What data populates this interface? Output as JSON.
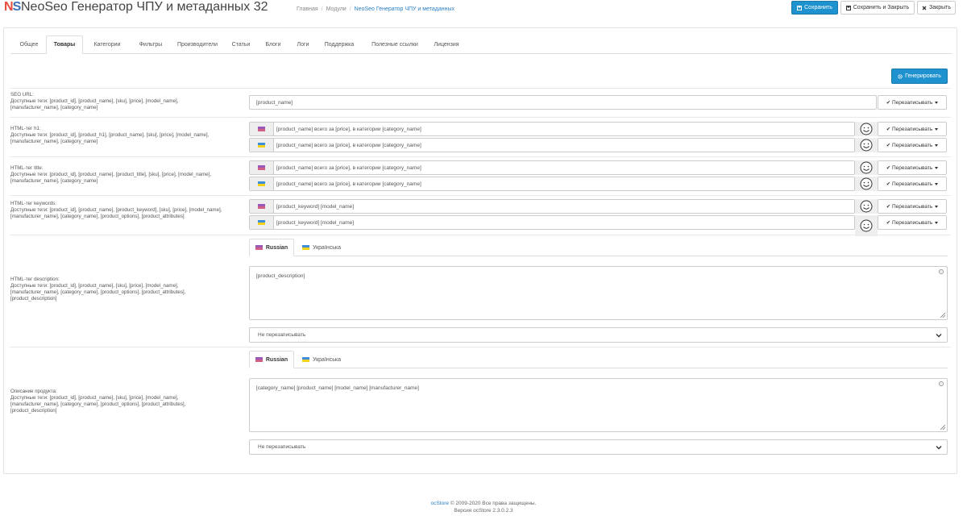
{
  "header": {
    "logo_n": "N",
    "logo_s": "S",
    "title": "NeoSeo Генератор ЧПУ и метаданных 32",
    "breadcrumbs": [
      "Главная",
      "Модули",
      "NeoSeo Генератор ЧПУ и метаданных"
    ],
    "save_label": "Сохранить",
    "save_close_label": "Сохранить и Закрыть",
    "close_label": "Закрыть"
  },
  "tabs": [
    {
      "label": "Общее"
    },
    {
      "label": "Товары"
    },
    {
      "label": "Категории"
    },
    {
      "label": "Фильтры"
    },
    {
      "label": "Производители"
    },
    {
      "label": "Статьи"
    },
    {
      "label": "Блоги"
    },
    {
      "label": "Логи"
    },
    {
      "label": "Поддержка"
    },
    {
      "label": "Полезные ссылки"
    },
    {
      "label": "Лицензия"
    }
  ],
  "generate_label": "Генерировать",
  "overwrite_label": "Перезаписывать",
  "languages": {
    "ru": "Russian",
    "ua": "Українська"
  },
  "seo_url": {
    "title": "SEO URL:",
    "tags": "Доступные теги: [product_id], [product_name], [sku], [price], [model_name], [manufacturer_name], [category_name]",
    "value": "[product_name]"
  },
  "h1": {
    "title": "HTML-тег h1:",
    "tags": "Доступные теги: [product_id], [product_h1], [product_name], [sku], [price], [model_name], [manufacturer_name], [category_name]",
    "ru": "[product_name] всего за [price], в категории [category_name]",
    "ua": "[product_name] всего за [price], в категории [category_name]"
  },
  "title_tag": {
    "title": "HTML-тег title:",
    "tags": "Доступные теги: [product_id], [product_name], [product_title], [sku], [price], [model_name], [manufacturer_name], [category_name]",
    "ru": "[product_name] всего за [price], в категории [category_name]",
    "ua": "[product_name] всего за [price], в категории [category_name]"
  },
  "keywords": {
    "title": "HTML-тег keywords:",
    "tags": "Доступные теги: [product_id], [product_name], [product_keyword], [sku], [price], [model_name], [manufacturer_name], [category_name], [product_options], [product_attributes]",
    "ru": "[product_keyword] [model_name]",
    "ua": "[product_keyword] [model_name]"
  },
  "description": {
    "title": "HTML-тег description:",
    "tags": "Доступные теги: [product_id], [product_name], [sku], [price], [model_name], [manufacturer_name], [category_name], [product_options], [product_attributes], [product_description]",
    "value": "[product_description]",
    "mode": "Не перезаписывать"
  },
  "product_desc": {
    "title": "Описание продукта:",
    "tags": "Доступные теги: [product_id], [product_name], [sku], [price], [model_name], [manufacturer_name], [category_name], [product_options], [product_attributes], [product_description]",
    "value": "[category_name] [product_name] [model_name] [manufacturer_name]",
    "mode": "Не перезаписывать"
  },
  "footer": {
    "link": "ocStore",
    "copyright": " © 2009-2020 Все права защищены.",
    "version": "Версия ocStore 2.3.0.2.3"
  },
  "colors": {
    "primary": "#1e91cf",
    "logo_red": "#e74c3c",
    "logo_blue": "#3b6fb6"
  }
}
